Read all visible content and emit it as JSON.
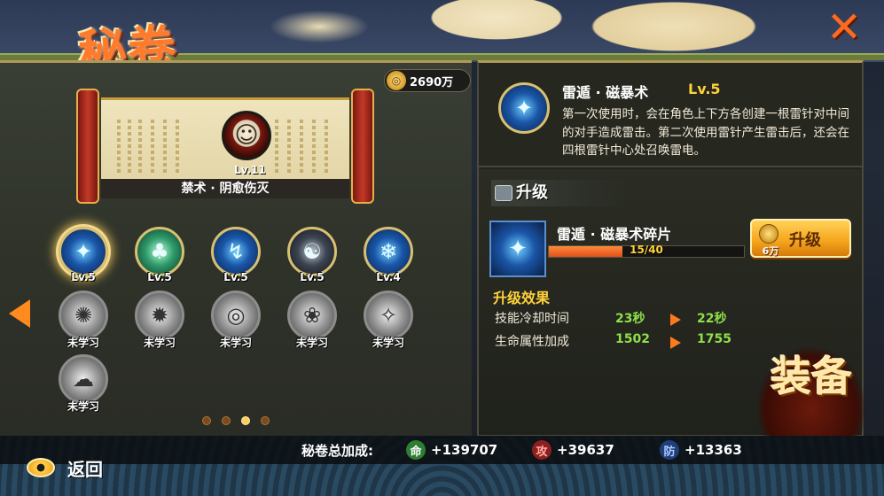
{
  "header": {
    "title": "秘卷",
    "close_icon": "close-icon"
  },
  "currency": {
    "amount": "2690万",
    "icon": "coin-icon",
    "glyph": "◎"
  },
  "scroll": {
    "level": "Lv.11",
    "name": "禁术 · 阴愈伤灭",
    "avatar_icon": "ninja-face-icon",
    "avatar_glyph": "☺"
  },
  "skills": [
    {
      "label": "Lv.5",
      "icon": "lightning-orb-icon",
      "glyph": "✦",
      "state": "learned",
      "tone": "blue",
      "selected": true
    },
    {
      "label": "Lv.5",
      "icon": "wind-ninja-icon",
      "glyph": "♣",
      "state": "learned",
      "tone": "green",
      "selected": false
    },
    {
      "label": "Lv.5",
      "icon": "lightning-rods-icon",
      "glyph": "↯",
      "state": "learned",
      "tone": "blue",
      "selected": false
    },
    {
      "label": "Lv.5",
      "icon": "shadow-ninja-icon",
      "glyph": "☯",
      "state": "learned",
      "tone": "dark",
      "selected": false
    },
    {
      "label": "Lv.4",
      "icon": "ice-shard-icon",
      "glyph": "❄",
      "state": "learned",
      "tone": "blue",
      "selected": false
    },
    {
      "label": "未学习",
      "icon": "cloaked-figure-icon",
      "glyph": "✺",
      "state": "locked"
    },
    {
      "label": "未学习",
      "icon": "burst-icon",
      "glyph": "✹",
      "state": "locked"
    },
    {
      "label": "未学习",
      "icon": "vortex-icon",
      "glyph": "◎",
      "state": "locked"
    },
    {
      "label": "未学习",
      "icon": "flame-spirit-icon",
      "glyph": "❀",
      "state": "locked"
    },
    {
      "label": "未学习",
      "icon": "crystal-icon",
      "glyph": "✧",
      "state": "locked"
    },
    {
      "label": "未学习",
      "icon": "storm-icon",
      "glyph": "☁",
      "state": "locked"
    }
  ],
  "pagination": {
    "total": 4,
    "active": 3
  },
  "detail": {
    "name": "雷遁 · 磁暴术",
    "level": "Lv.5",
    "icon": "lightning-orb-icon",
    "glyph": "✦",
    "description": "第一次使用时，会在角色上下方各创建一根雷针对中间的对手造成雷击。第二次使用雷针产生雷击后，还会在四根雷针中心处召唤雷电。"
  },
  "upgrade": {
    "section_title": "升级",
    "fragment_name": "雷遁 · 磁暴术碎片",
    "fragment_icon": "lightning-orb-icon",
    "fragment_glyph": "✦",
    "fragment_progress": "15/40",
    "fragment_fraction": 0.375,
    "cost": "6万",
    "button_label": "升级"
  },
  "effects": {
    "title": "升级效果",
    "rows": [
      {
        "label": "技能冷却时间",
        "old": "23秒",
        "new": "22秒"
      },
      {
        "label": "生命属性加成",
        "old": "1502",
        "new": "1755"
      }
    ]
  },
  "equip": {
    "label": "装备"
  },
  "footer": {
    "back_label": "返回",
    "back_icon": "eye-back-icon",
    "bonus_label": "秘卷总加成:",
    "bonuses": [
      {
        "badge": "命",
        "value": "+139707",
        "type": "hp"
      },
      {
        "badge": "攻",
        "value": "+39637",
        "type": "atk"
      },
      {
        "badge": "防",
        "value": "+13363",
        "type": "def"
      }
    ]
  },
  "colors": {
    "accent": "#ff7a2b",
    "gold": "#ffd23a",
    "stat_green": "#8ee04a",
    "panel": "#23241f"
  }
}
